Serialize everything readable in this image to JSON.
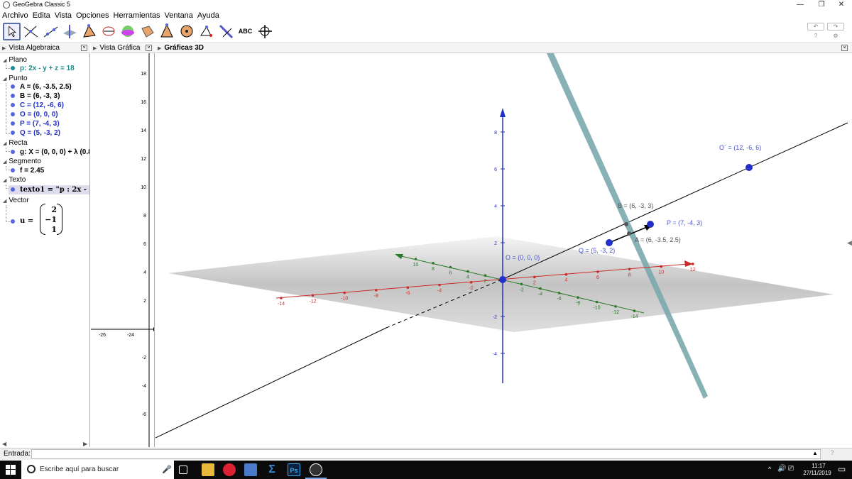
{
  "window": {
    "title": "GeoGebra Classic 5",
    "controls": {
      "minimize": "—",
      "restore": "❐",
      "close": "✕"
    }
  },
  "menu": [
    "Archivo",
    "Edita",
    "Vista",
    "Opciones",
    "Herramientas",
    "Ventana",
    "Ayuda"
  ],
  "toolbar": {
    "tools": [
      "move-tool",
      "perpendicular-line-tool",
      "line-tool",
      "plane-intersection-tool",
      "polygon-tool",
      "circle-tool",
      "sphere-tool",
      "angle-tool",
      "pyramid-tool",
      "dot-sphere-tool",
      "reflect-point-tool",
      "perpendicular-plane-tool",
      "text-tool",
      "view-rotate-tool"
    ],
    "text_tool_label": "ABC",
    "undo_icon": "↶",
    "redo_icon": "↷",
    "help_icon": "?",
    "settings_icon": "⚙"
  },
  "panels": {
    "algebra_title": "Vista Algebraica",
    "graphics_title": "Vista Gráfica",
    "graphics3d_title": "Gráficas 3D"
  },
  "algebra": {
    "groups": [
      {
        "name": "Plano",
        "items": [
          "p: 2x - y + z = 18"
        ]
      },
      {
        "name": "Punto",
        "items": [
          "A = (6, -3.5, 2.5)",
          "B = (6, -3, 3)",
          "C = (12, -6, 6)",
          "O = (0, 0, 0)",
          "P = (7, -4, 3)",
          "Q = (5, -3, 2)"
        ]
      },
      {
        "name": "Recta",
        "items": [
          "g: X = (0, 0, 0) + λ (0.8"
        ]
      },
      {
        "name": "Segmento",
        "items": [
          "f = 2.45"
        ]
      },
      {
        "name": "Texto",
        "items": [
          "texto1 = \"p : 2x -"
        ]
      },
      {
        "name": "Vector",
        "items": [
          "u ="
        ]
      }
    ],
    "vector_u": [
      "2",
      "−1",
      "1"
    ]
  },
  "graphics2d": {
    "y_ticks": [
      "18",
      "16",
      "14",
      "12",
      "10",
      "8",
      "6",
      "4",
      "2",
      "-2",
      "-4",
      "-6"
    ],
    "x_ticks": [
      "-26",
      "-24"
    ]
  },
  "graphics3d": {
    "x_ticks": [
      "-14",
      "-12",
      "-10",
      "-8",
      "-6",
      "-4",
      "-2",
      "2",
      "4",
      "6",
      "8",
      "10",
      "12"
    ],
    "y_ticks_back": [
      "10",
      "8",
      "6",
      "4",
      "2"
    ],
    "y_ticks_front": [
      "-2",
      "-4",
      "-6",
      "-8",
      "-10",
      "-12",
      "-14"
    ],
    "z_ticks": [
      "8",
      "6",
      "4",
      "2",
      "-2",
      "-4"
    ],
    "labels": {
      "origin": "O = (0, 0, 0)",
      "c_point": "O´ = (12, -6, 6)",
      "b_point": "B = (6, -3, 3)",
      "p_point": "P = (7, -4, 3)",
      "a_point": "A = (6, -3.5, 2.5)",
      "q_point": "Q = (5, -3, 2)"
    },
    "colors": {
      "x_axis": "#cc2a2a",
      "y_axis": "#2a7a2a",
      "z_axis": "#2230c8",
      "point": "#2230c8",
      "plane": "#7aa9ad"
    }
  },
  "input": {
    "label": "Entrada:",
    "value": "",
    "help": "?"
  },
  "taskbar": {
    "search_placeholder": "Escribe aquí para buscar",
    "apps": [
      "task-view",
      "file-explorer",
      "chrome",
      "app-generic",
      "sigma-app",
      "photoshop",
      "geogebra"
    ],
    "photoshop_label": "Ps",
    "time": "11:17",
    "date": "27/11/2019"
  }
}
